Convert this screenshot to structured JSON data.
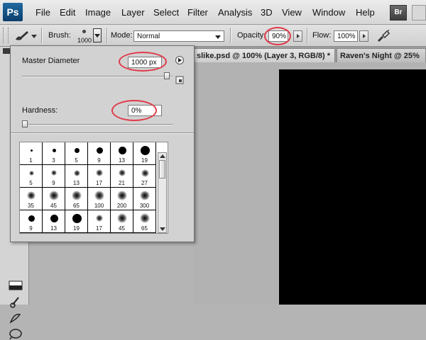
{
  "menubar": {
    "logo": "Ps",
    "items": [
      "File",
      "Edit",
      "Image",
      "Layer",
      "Select",
      "Filter",
      "Analysis",
      "3D",
      "View",
      "Window",
      "Help"
    ],
    "bridge_label": "Br"
  },
  "options": {
    "brush_label": "Brush:",
    "brush_size": "1000",
    "mode_label": "Mode:",
    "mode_value": "Normal",
    "opacity_label": "Opacity:",
    "opacity_value": "90%",
    "flow_label": "Flow:",
    "flow_value": "100%"
  },
  "tabs": [
    "slike.psd @ 100% (Layer 3, RGB/8) *",
    "Raven's Night @ 25%"
  ],
  "brush_panel": {
    "master_diameter_label": "Master Diameter",
    "master_diameter_value": "1000 px",
    "master_diameter_level": 0.98,
    "hardness_label": "Hardness:",
    "hardness_value": "0%",
    "hardness_level": 0.0,
    "presets": [
      {
        "size": "1",
        "type": "hard"
      },
      {
        "size": "3",
        "type": "hard"
      },
      {
        "size": "5",
        "type": "hard"
      },
      {
        "size": "9",
        "type": "hard"
      },
      {
        "size": "13",
        "type": "hard"
      },
      {
        "size": "19",
        "type": "hard"
      },
      {
        "size": "5",
        "type": "soft"
      },
      {
        "size": "9",
        "type": "soft"
      },
      {
        "size": "13",
        "type": "soft"
      },
      {
        "size": "17",
        "type": "soft"
      },
      {
        "size": "21",
        "type": "soft"
      },
      {
        "size": "27",
        "type": "soft"
      },
      {
        "size": "35",
        "type": "soft"
      },
      {
        "size": "45",
        "type": "soft"
      },
      {
        "size": "65",
        "type": "soft"
      },
      {
        "size": "100",
        "type": "soft"
      },
      {
        "size": "200",
        "type": "soft"
      },
      {
        "size": "300",
        "type": "soft"
      },
      {
        "size": "9",
        "type": "hard"
      },
      {
        "size": "13",
        "type": "hard"
      },
      {
        "size": "19",
        "type": "hard"
      },
      {
        "size": "17",
        "type": "soft"
      },
      {
        "size": "45",
        "type": "soft"
      },
      {
        "size": "65",
        "type": "soft"
      }
    ]
  },
  "colors": {
    "annotation_red": "#e03a4a",
    "canvas": "#000000"
  }
}
